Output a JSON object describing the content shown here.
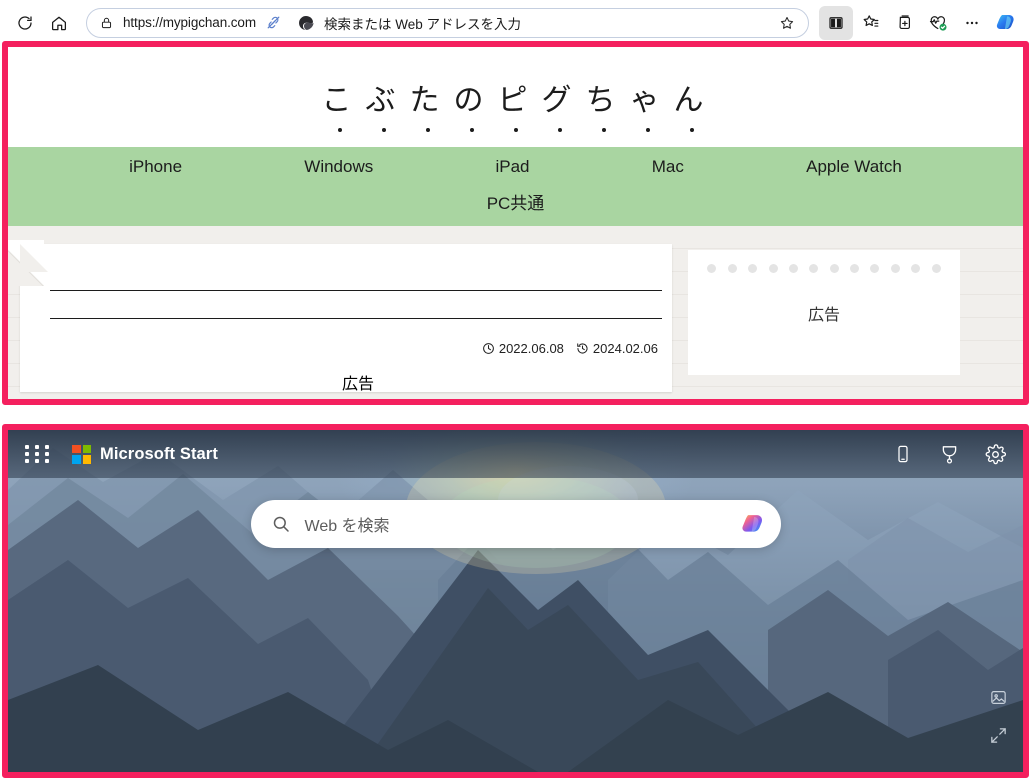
{
  "browser": {
    "refresh_label": "refresh",
    "home_label": "home",
    "omnibox": {
      "url_text": "https://mypigchan.com",
      "placeholder": "検索または Web アドレスを入力",
      "lock_icon": "lock-icon",
      "split_icon": "split-screen-link-icon",
      "edge_icon": "edge-copilot-icon",
      "favorite_icon": "star-icon"
    },
    "toolbar_icons": [
      {
        "name": "split-screen-button",
        "label": "分割画面"
      },
      {
        "name": "favorites-button",
        "label": "お気に入り"
      },
      {
        "name": "collections-button",
        "label": "コレクション"
      },
      {
        "name": "browser-essentials-button",
        "label": "ブラウザー エッセンシャル"
      },
      {
        "name": "settings-and-more-button",
        "label": "設定など"
      },
      {
        "name": "copilot-button",
        "label": "Copilot"
      }
    ]
  },
  "site": {
    "title": "こぶたのピグちゃん",
    "title_chars": [
      "こ",
      "ぶ",
      "た",
      "の",
      "ピ",
      "グ",
      "ち",
      "ゃ",
      "ん"
    ],
    "nav_row1": [
      "iPhone",
      "Windows",
      "iPad",
      "Mac",
      "Apple Watch"
    ],
    "nav_row2": [
      "PC共通"
    ],
    "nav_bg_color": "#a9d5a1",
    "article": {
      "published_date": "2022.06.08",
      "updated_date": "2024.02.06",
      "published_icon": "clock-icon",
      "updated_icon": "history-icon"
    },
    "ads": {
      "sidebar_label": "広告",
      "bottom_label": "広告"
    }
  },
  "msstart": {
    "app_grid_icon": "app-grid-icon",
    "brand": "Microsoft Start",
    "brand_logo_icon": "microsoft-logo-icon",
    "header_icons": [
      {
        "name": "mobile-phone-icon",
        "label": "モバイル"
      },
      {
        "name": "rewards-medal-icon",
        "label": "Rewards"
      },
      {
        "name": "settings-gear-icon",
        "label": "設定"
      }
    ],
    "search": {
      "placeholder": "Web を検索",
      "search_icon": "search-icon",
      "copilot_icon": "copilot-icon"
    },
    "image_tools": [
      {
        "name": "image-info-icon",
        "label": "画像情報"
      },
      {
        "name": "expand-fullscreen-icon",
        "label": "全画面表示"
      }
    ]
  },
  "highlights": {
    "color": "#f4205e",
    "regions": [
      {
        "name": "webpage-region",
        "label": "Web ページ領域"
      },
      {
        "name": "microsoft-start-region",
        "label": "Microsoft Start 領域"
      }
    ]
  }
}
